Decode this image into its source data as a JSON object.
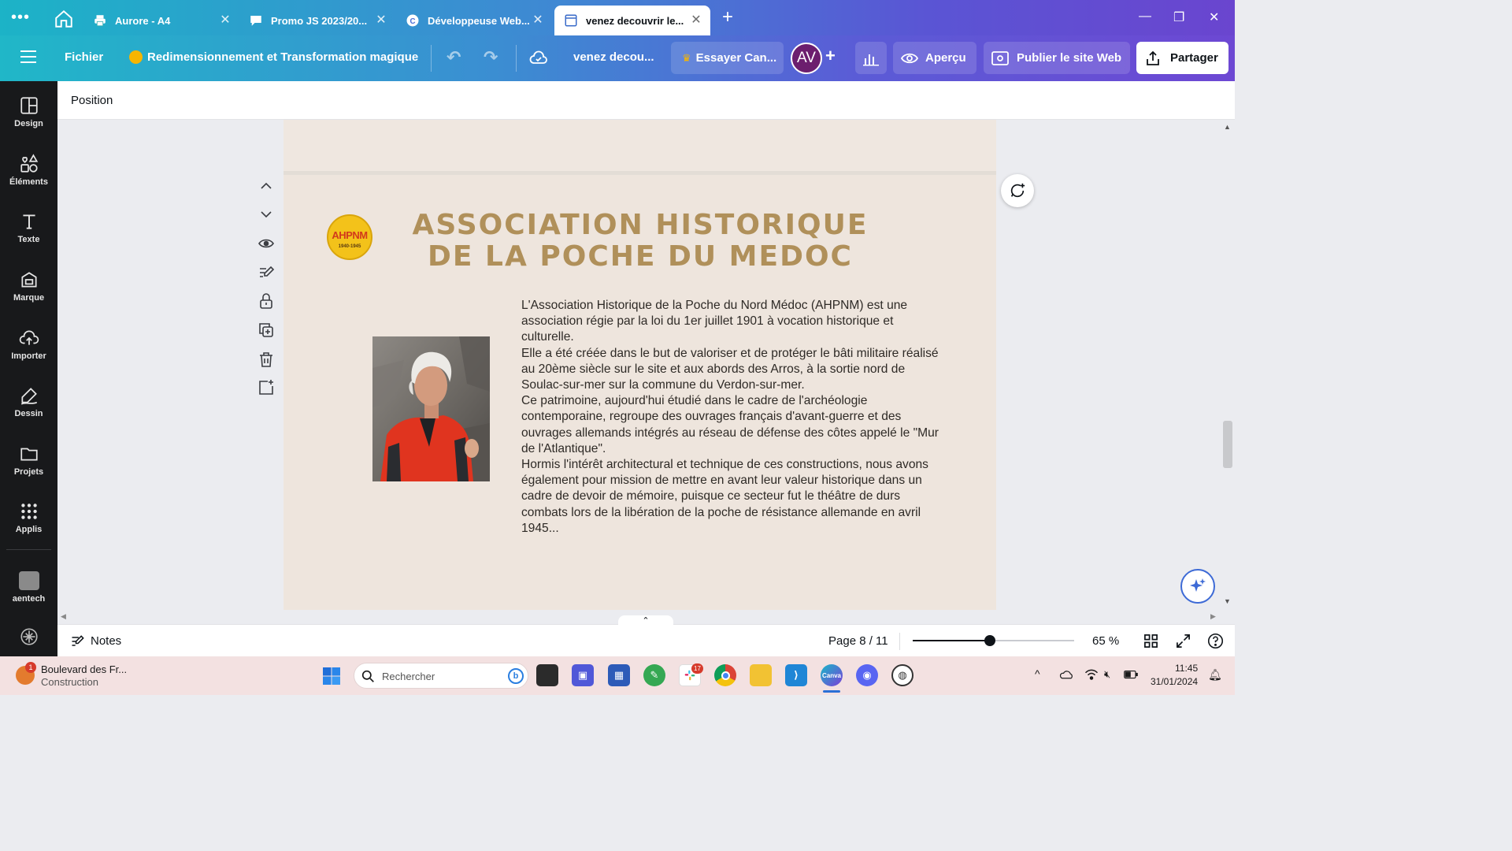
{
  "browser": {
    "tabs": [
      {
        "title": "Aurore - A4",
        "icon": "printer-icon"
      },
      {
        "title": "Promo JS 2023/20...",
        "icon": "chat-icon"
      },
      {
        "title": "Développeuse Web...",
        "icon": "c-logo-icon"
      },
      {
        "title": "venez decouvrir le...",
        "icon": "page-icon",
        "active": true
      }
    ]
  },
  "header": {
    "file_menu": "Fichier",
    "resize_label": "Redimensionnement et Transformation magique",
    "doc_title": "venez decou...",
    "try_pro": "Essayer Can...",
    "avatar_initials": "AV",
    "preview": "Aperçu",
    "publish": "Publier le site Web",
    "share": "Partager"
  },
  "sidebar": {
    "items": [
      {
        "label": "Design",
        "icon": "layout-icon"
      },
      {
        "label": "Éléments",
        "icon": "shapes-icon"
      },
      {
        "label": "Texte",
        "icon": "text-icon"
      },
      {
        "label": "Marque",
        "icon": "brand-icon"
      },
      {
        "label": "Importer",
        "icon": "upload-cloud-icon"
      },
      {
        "label": "Dessin",
        "icon": "draw-icon"
      },
      {
        "label": "Projets",
        "icon": "folder-icon"
      },
      {
        "label": "Applis",
        "icon": "apps-grid-icon"
      }
    ],
    "extra": "aentech"
  },
  "toolbar": {
    "position_label": "Position"
  },
  "page_content": {
    "logo_text": "AHPNM",
    "logo_years": "1940-1945",
    "heading_line1": "ASSOCIATION HISTORIQUE",
    "heading_line2": "DE LA POCHE DU MEDOC",
    "paragraphs": [
      "L'Association Historique de la Poche du Nord Médoc (AHPNM) est une association régie par la loi du 1er juillet 1901 à vocation historique et culturelle.",
      "Elle a été créée dans le but de valoriser et de protéger le bâti militaire réalisé au 20ème siècle sur le site et aux abords des Arros, à la sortie nord de Soulac-sur-mer sur la commune du Verdon-sur-mer.",
      "Ce patrimoine, aujourd'hui étudié dans le cadre de l'archéologie contemporaine, regroupe des ouvrages français d'avant-guerre et des ouvrages allemands intégrés au réseau de défense des côtes appelé le \"Mur de l'Atlantique\".",
      "Hormis l'intérêt architectural et technique de ces constructions, nous avons également pour mission de mettre en avant leur valeur historique dans un cadre de devoir de mémoire, puisque ce secteur fut le théâtre de durs combats lors de la libération de la poche de résistance allemande en avril 1945..."
    ]
  },
  "bottom_bar": {
    "notes": "Notes",
    "page_indicator": "Page 8 / 11",
    "zoom_value": 65,
    "zoom_label": "65 %"
  },
  "taskbar": {
    "notification_title": "Boulevard des Fr...",
    "notification_sub": "Construction",
    "notification_badge": "1",
    "search_placeholder": "Rechercher",
    "slack_badge": "17",
    "time": "11:45",
    "date": "31/01/2024"
  },
  "colors": {
    "header_start": "#20b7c8",
    "header_end": "#6d48d3",
    "heading_gold": "#b0905a",
    "page_bg": "#eee5dd"
  }
}
